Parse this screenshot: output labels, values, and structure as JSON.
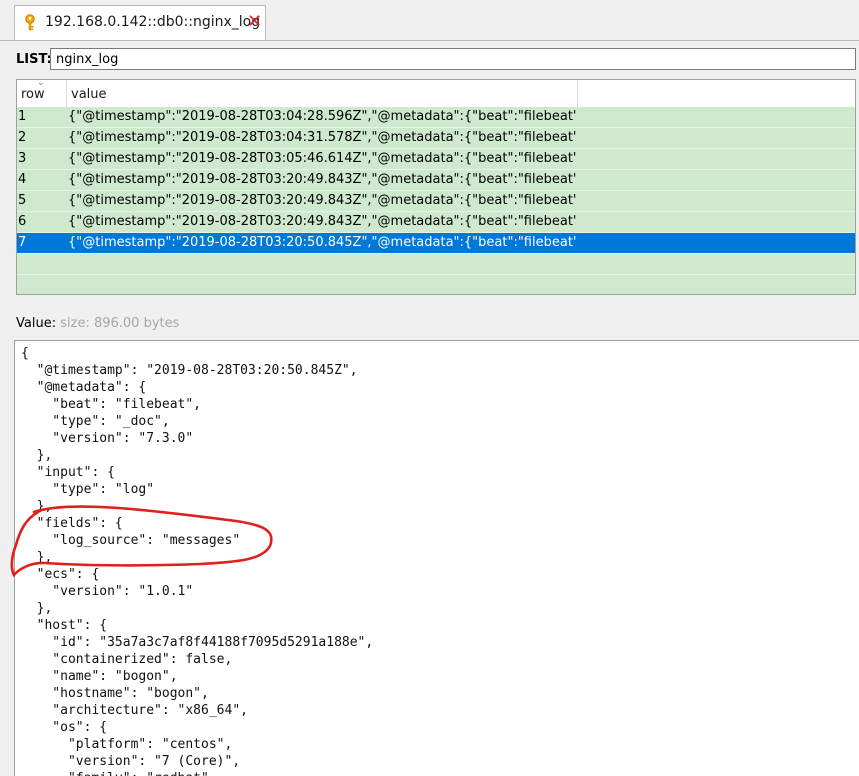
{
  "tab": {
    "title": "192.168.0.142::db0::nginx_log",
    "close_glyph": "✕",
    "icon": "key-icon"
  },
  "list": {
    "label": "LIST:",
    "value": "nginx_log"
  },
  "table": {
    "columns": [
      "row",
      "value"
    ],
    "rows": [
      {
        "row": "1",
        "value": "{\"@timestamp\":\"2019-08-28T03:04:28.596Z\",\"@metadata\":{\"beat\":\"filebeat\"..."
      },
      {
        "row": "2",
        "value": "{\"@timestamp\":\"2019-08-28T03:04:31.578Z\",\"@metadata\":{\"beat\":\"filebeat\"..."
      },
      {
        "row": "3",
        "value": "{\"@timestamp\":\"2019-08-28T03:05:46.614Z\",\"@metadata\":{\"beat\":\"filebeat\"..."
      },
      {
        "row": "4",
        "value": "{\"@timestamp\":\"2019-08-28T03:20:49.843Z\",\"@metadata\":{\"beat\":\"filebeat\"..."
      },
      {
        "row": "5",
        "value": "{\"@timestamp\":\"2019-08-28T03:20:49.843Z\",\"@metadata\":{\"beat\":\"filebeat\"..."
      },
      {
        "row": "6",
        "value": "{\"@timestamp\":\"2019-08-28T03:20:49.843Z\",\"@metadata\":{\"beat\":\"filebeat\"..."
      },
      {
        "row": "7",
        "value": "{\"@timestamp\":\"2019-08-28T03:20:50.845Z\",\"@metadata\":{\"beat\":\"filebeat\"..."
      }
    ],
    "selected_row": "7"
  },
  "value_panel": {
    "label": "Value:",
    "size": "size: 896.00 bytes"
  },
  "json_text": "{\n  \"@timestamp\": \"2019-08-28T03:20:50.845Z\",\n  \"@metadata\": {\n    \"beat\": \"filebeat\",\n    \"type\": \"_doc\",\n    \"version\": \"7.3.0\"\n  },\n  \"input\": {\n    \"type\": \"log\"\n  },\n  \"fields\": {\n    \"log_source\": \"messages\"\n  },\n  \"ecs\": {\n    \"version\": \"1.0.1\"\n  },\n  \"host\": {\n    \"id\": \"35a7a3c7af8f44188f7095d5291a188e\",\n    \"containerized\": false,\n    \"name\": \"bogon\",\n    \"hostname\": \"bogon\",\n    \"architecture\": \"x86_64\",\n    \"os\": {\n      \"platform\": \"centos\",\n      \"version\": \"7 (Core)\",\n      \"family\": \"redhat\",",
  "colors": {
    "row_bg": "#cfe9cf",
    "selected_bg": "#0078d7",
    "annotation": "#e0201c",
    "close": "#dd2222"
  }
}
